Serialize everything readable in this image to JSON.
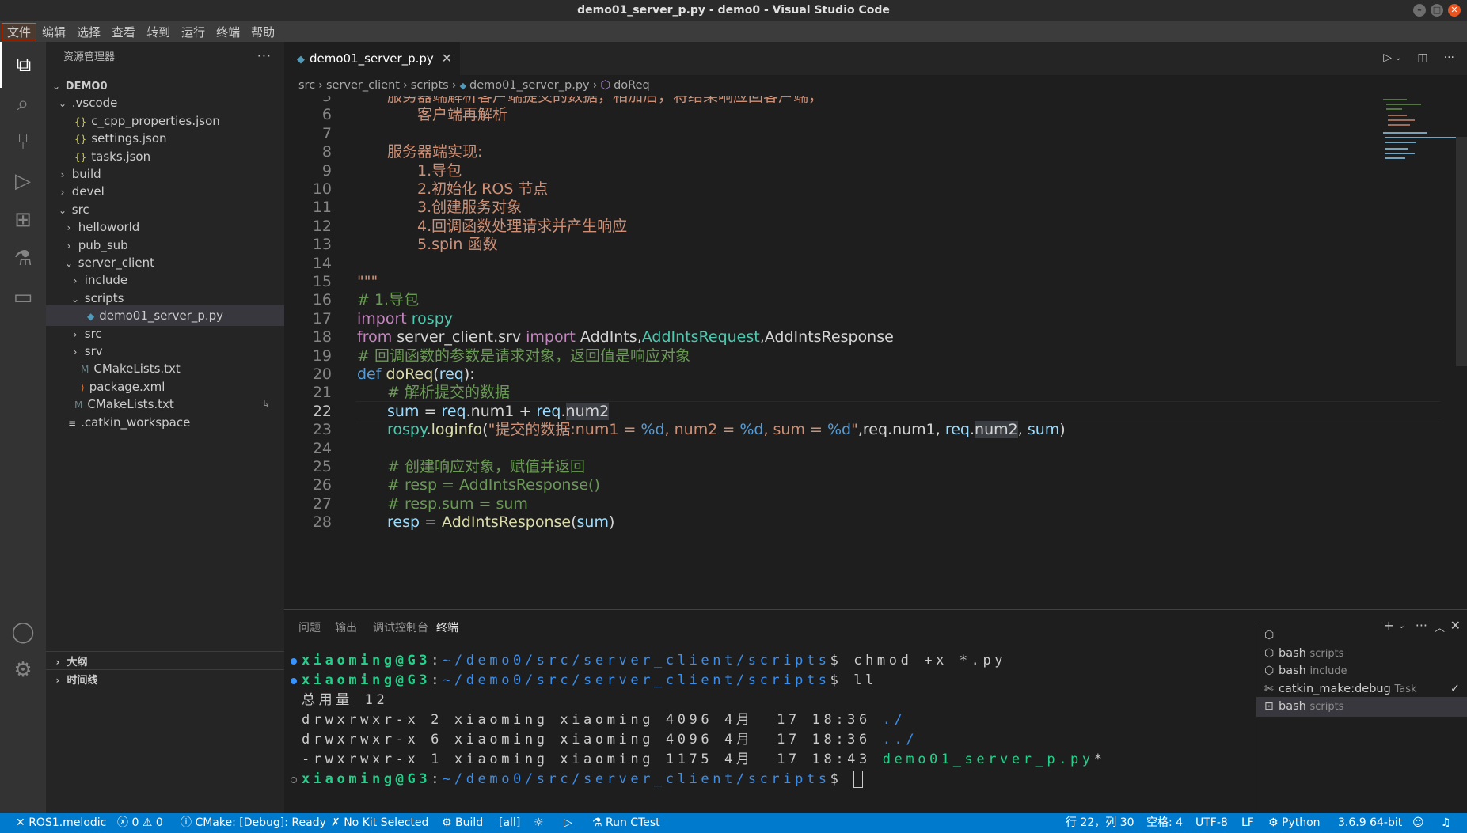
{
  "window": {
    "title": "demo01_server_p.py - demo0 - Visual Studio Code"
  },
  "menu": [
    "文件",
    "编辑",
    "选择",
    "查看",
    "转到",
    "运行",
    "终端",
    "帮助"
  ],
  "activity_icons": [
    "files-icon",
    "search-icon",
    "source-control-icon",
    "run-debug-icon",
    "extensions-icon",
    "testing-icon",
    "remote-explorer-icon",
    "account-icon",
    "settings-gear-icon"
  ],
  "sidebar": {
    "title": "资源管理器",
    "more": "···",
    "tree": [
      {
        "label": "DEMO0",
        "type": "root",
        "depth": 0,
        "expanded": true
      },
      {
        "label": ".vscode",
        "type": "folder",
        "depth": 1,
        "expanded": true
      },
      {
        "label": "c_cpp_properties.json",
        "type": "json",
        "depth": 2
      },
      {
        "label": "settings.json",
        "type": "json",
        "depth": 2
      },
      {
        "label": "tasks.json",
        "type": "json",
        "depth": 2
      },
      {
        "label": "build",
        "type": "folder",
        "depth": 1,
        "expanded": false
      },
      {
        "label": "devel",
        "type": "folder",
        "depth": 1,
        "expanded": false
      },
      {
        "label": "src",
        "type": "folder",
        "depth": 1,
        "expanded": true
      },
      {
        "label": "helloworld",
        "type": "folder",
        "depth": 2,
        "expanded": false
      },
      {
        "label": "pub_sub",
        "type": "folder",
        "depth": 2,
        "expanded": false
      },
      {
        "label": "server_client",
        "type": "folder",
        "depth": 2,
        "expanded": true
      },
      {
        "label": "include",
        "type": "folder",
        "depth": 3,
        "expanded": false
      },
      {
        "label": "scripts",
        "type": "folder",
        "depth": 3,
        "expanded": true
      },
      {
        "label": "demo01_server_p.py",
        "type": "python",
        "depth": 4,
        "selected": true
      },
      {
        "label": "src",
        "type": "folder",
        "depth": 3,
        "expanded": false
      },
      {
        "label": "srv",
        "type": "folder",
        "depth": 3,
        "expanded": false
      },
      {
        "label": "CMakeLists.txt",
        "type": "cmake",
        "depth": 3
      },
      {
        "label": "package.xml",
        "type": "xml",
        "depth": 3
      },
      {
        "label": "CMakeLists.txt",
        "type": "cmake",
        "depth": 2,
        "badge": "↳"
      },
      {
        "label": ".catkin_workspace",
        "type": "text",
        "depth": 1
      }
    ],
    "outline": "大纲",
    "timeline": "时间线"
  },
  "editor": {
    "tab": "demo01_server_p.py",
    "breadcrumb": [
      "src",
      "server_client",
      "scripts",
      "demo01_server_p.py",
      "doReq"
    ],
    "current_line": 22,
    "lines": [
      {
        "n": "5",
        "indent": "  ",
        "tokens": [
          [
            "服务器端解析客户端提交的数据，相加后，将结果响应回客户端，",
            "str"
          ]
        ]
      },
      {
        "n": "6",
        "indent": "    ",
        "tokens": [
          [
            "客户端再解析",
            "str"
          ]
        ]
      },
      {
        "n": "7",
        "indent": "",
        "tokens": []
      },
      {
        "n": "8",
        "indent": "  ",
        "tokens": [
          [
            "服务器端实现:",
            "str"
          ]
        ]
      },
      {
        "n": "9",
        "indent": "    ",
        "tokens": [
          [
            "1.导包",
            "str"
          ]
        ]
      },
      {
        "n": "10",
        "indent": "    ",
        "tokens": [
          [
            "2.初始化 ROS 节点",
            "str"
          ]
        ]
      },
      {
        "n": "11",
        "indent": "    ",
        "tokens": [
          [
            "3.创建服务对象",
            "str"
          ]
        ]
      },
      {
        "n": "12",
        "indent": "    ",
        "tokens": [
          [
            "4.回调函数处理请求并产生响应",
            "str"
          ]
        ]
      },
      {
        "n": "13",
        "indent": "    ",
        "tokens": [
          [
            "5.spin 函数",
            "str"
          ]
        ]
      },
      {
        "n": "14",
        "indent": "",
        "tokens": []
      },
      {
        "n": "15",
        "indent": "",
        "tokens": [
          [
            "\"\"\"",
            "str"
          ]
        ]
      },
      {
        "n": "16",
        "indent": "",
        "tokens": [
          [
            "# 1.导包",
            "cmt"
          ]
        ]
      },
      {
        "n": "17",
        "indent": "",
        "tokens": [
          [
            "import ",
            "kw"
          ],
          [
            "rospy",
            "mod"
          ]
        ]
      },
      {
        "n": "18",
        "indent": "",
        "tokens": [
          [
            "from ",
            "kw"
          ],
          [
            "server_client.srv ",
            "plain"
          ],
          [
            "import ",
            "kw"
          ],
          [
            "AddInts",
            "plain"
          ],
          [
            ",",
            "plain"
          ],
          [
            "AddIntsRequest",
            "mod"
          ],
          [
            ",",
            "plain"
          ],
          [
            "AddIntsResponse",
            "plain"
          ]
        ]
      },
      {
        "n": "19",
        "indent": "",
        "tokens": [
          [
            "# 回调函数的参数是请求对象，返回值是响应对象",
            "cmt"
          ]
        ]
      },
      {
        "n": "20",
        "indent": "",
        "tokens": [
          [
            "def ",
            "def"
          ],
          [
            "doReq",
            "fn"
          ],
          [
            "(",
            "plain"
          ],
          [
            "req",
            "var"
          ],
          [
            "):",
            "plain"
          ]
        ]
      },
      {
        "n": "21",
        "indent": "  ",
        "tokens": [
          [
            "# 解析提交的数据",
            "cmt"
          ]
        ]
      },
      {
        "n": "22",
        "indent": "  ",
        "tokens": [
          [
            "sum",
            "var"
          ],
          [
            " = ",
            "plain"
          ],
          [
            "req",
            "var"
          ],
          [
            ".num1 + ",
            "plain"
          ],
          [
            "req",
            "var"
          ],
          [
            ".",
            "plain"
          ],
          [
            "num2",
            "hl"
          ]
        ]
      },
      {
        "n": "23",
        "indent": "  ",
        "tokens": [
          [
            "rospy",
            "mod"
          ],
          [
            ".",
            "plain"
          ],
          [
            "loginfo",
            "fn"
          ],
          [
            "(",
            "plain"
          ],
          [
            "\"提交的数据:num1 = ",
            "str"
          ],
          [
            "%d",
            "fmt"
          ],
          [
            ", num2 = ",
            "str"
          ],
          [
            "%d",
            "fmt"
          ],
          [
            ", sum = ",
            "str"
          ],
          [
            "%d",
            "fmt"
          ],
          [
            "\"",
            "str"
          ],
          [
            ",req.num1, ",
            "plain"
          ],
          [
            "req",
            "var"
          ],
          [
            ".",
            "plain"
          ],
          [
            "num2",
            "hl"
          ],
          [
            ", ",
            "plain"
          ],
          [
            "sum",
            "var"
          ],
          [
            ")",
            "plain"
          ]
        ]
      },
      {
        "n": "24",
        "indent": "",
        "tokens": []
      },
      {
        "n": "25",
        "indent": "  ",
        "tokens": [
          [
            "# 创建响应对象，赋值并返回",
            "cmt"
          ]
        ]
      },
      {
        "n": "26",
        "indent": "  ",
        "tokens": [
          [
            "# resp = AddIntsResponse()",
            "cmt"
          ]
        ]
      },
      {
        "n": "27",
        "indent": "  ",
        "tokens": [
          [
            "# resp.sum = sum",
            "cmt"
          ]
        ]
      },
      {
        "n": "28",
        "indent": "  ",
        "tokens": [
          [
            "resp",
            "var"
          ],
          [
            " = ",
            "plain"
          ],
          [
            "AddIntsResponse",
            "fn"
          ],
          [
            "(",
            "plain"
          ],
          [
            "sum",
            "var"
          ],
          [
            ")",
            "plain"
          ]
        ]
      }
    ]
  },
  "panel": {
    "tabs": [
      "问题",
      "输出",
      "调试控制台",
      "终端"
    ],
    "active_tab": "终端",
    "terminal_lines": [
      {
        "dot": "blue",
        "parts": [
          [
            "xiaoming@G3",
            "user"
          ],
          [
            ":",
            "plain"
          ],
          [
            "~/demo0/src/server_client/scripts",
            "path"
          ],
          [
            "$ chmod +x *.py",
            "plain"
          ]
        ]
      },
      {
        "dot": "blue",
        "parts": [
          [
            "xiaoming@G3",
            "user"
          ],
          [
            ":",
            "plain"
          ],
          [
            "~/demo0/src/server_client/scripts",
            "path"
          ],
          [
            "$ ll",
            "plain"
          ]
        ]
      },
      {
        "dot": "",
        "parts": [
          [
            "总用量 12",
            "plain"
          ]
        ]
      },
      {
        "dot": "",
        "parts": [
          [
            "drwxrwxr-x 2 xiaoming xiaoming 4096 4月  17 18:36 ",
            "plain"
          ],
          [
            "./",
            "path"
          ]
        ]
      },
      {
        "dot": "",
        "parts": [
          [
            "drwxrwxr-x 6 xiaoming xiaoming 4096 4月  17 18:36 ",
            "plain"
          ],
          [
            "../",
            "path"
          ]
        ]
      },
      {
        "dot": "",
        "parts": [
          [
            "-rwxrwxr-x 1 xiaoming xiaoming 1175 4月  17 18:43 ",
            "plain"
          ],
          [
            "demo01_server_p.py",
            "exec"
          ],
          [
            "*",
            "plain"
          ]
        ]
      },
      {
        "dot": "hollow",
        "parts": [
          [
            "xiaoming@G3",
            "user"
          ],
          [
            ":",
            "plain"
          ],
          [
            "~/demo0/src/server_client/scripts",
            "path"
          ],
          [
            "$ ",
            "plain"
          ]
        ],
        "cursor": true
      }
    ],
    "terminals": [
      {
        "name": "",
        "sub": "",
        "icon": "cube-icon"
      },
      {
        "name": "bash",
        "sub": "scripts",
        "icon": "cube-icon"
      },
      {
        "name": "bash",
        "sub": "include",
        "icon": "cube-icon"
      },
      {
        "name": "catkin_make:debug",
        "sub": "Task",
        "icon": "tools-icon",
        "check": "✓"
      },
      {
        "name": "bash",
        "sub": "scripts",
        "icon": "terminal-icon",
        "active": true
      }
    ]
  },
  "status": {
    "ros": "ROS1.melodic",
    "errors": "0",
    "warnings": "0",
    "cmake": "CMake: [Debug]: Ready",
    "kit": "No Kit Selected",
    "build": "Build",
    "target": "[all]",
    "ctest": "Run CTest",
    "position": "行 22，列 30",
    "spaces": "空格: 4",
    "encoding": "UTF-8",
    "eol": "LF",
    "language": "Python",
    "interpreter": "3.6.9 64-bit"
  },
  "colors": {
    "accent": "#007acc",
    "menu_highlight": "#e95420"
  }
}
